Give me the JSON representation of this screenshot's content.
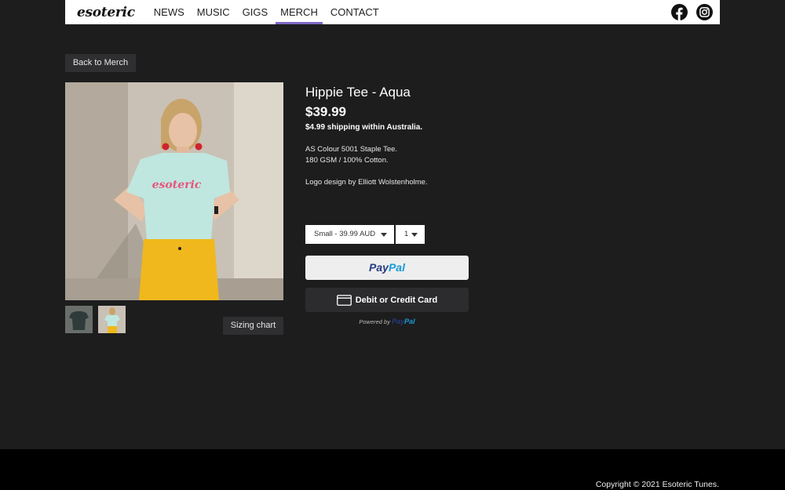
{
  "header": {
    "logo": "esoteric",
    "nav": [
      {
        "label": "NEWS"
      },
      {
        "label": "MUSIC"
      },
      {
        "label": "GIGS"
      },
      {
        "label": "MERCH",
        "active": true
      },
      {
        "label": "CONTACT"
      }
    ],
    "socials": [
      "facebook-icon",
      "instagram-icon"
    ]
  },
  "back_button": "Back to Merch",
  "product": {
    "title": "Hippie Tee - Aqua",
    "price": "$39.99",
    "shipping": "$4.99 shipping within Australia.",
    "description": [
      "AS Colour 5001 Staple Tee.",
      "180 GSM / 100% Cotton.",
      "Logo design by Elliott Wolstenholme."
    ],
    "size_select": "Small - 39.99 AUD",
    "qty_select": "1",
    "sizing_chart": "Sizing chart"
  },
  "payment": {
    "paypal_a": "Pay",
    "paypal_b": "Pal",
    "card_label": "Debit or Credit Card",
    "powered_by": "Powered by"
  },
  "footer": {
    "copyright": "Copyright © 2021 Esoteric Tunes."
  },
  "colors": {
    "background": "#1d1d1e",
    "accent": "#7f68c6",
    "paypal_dark": "#253b80",
    "paypal_light": "#179bd7"
  }
}
